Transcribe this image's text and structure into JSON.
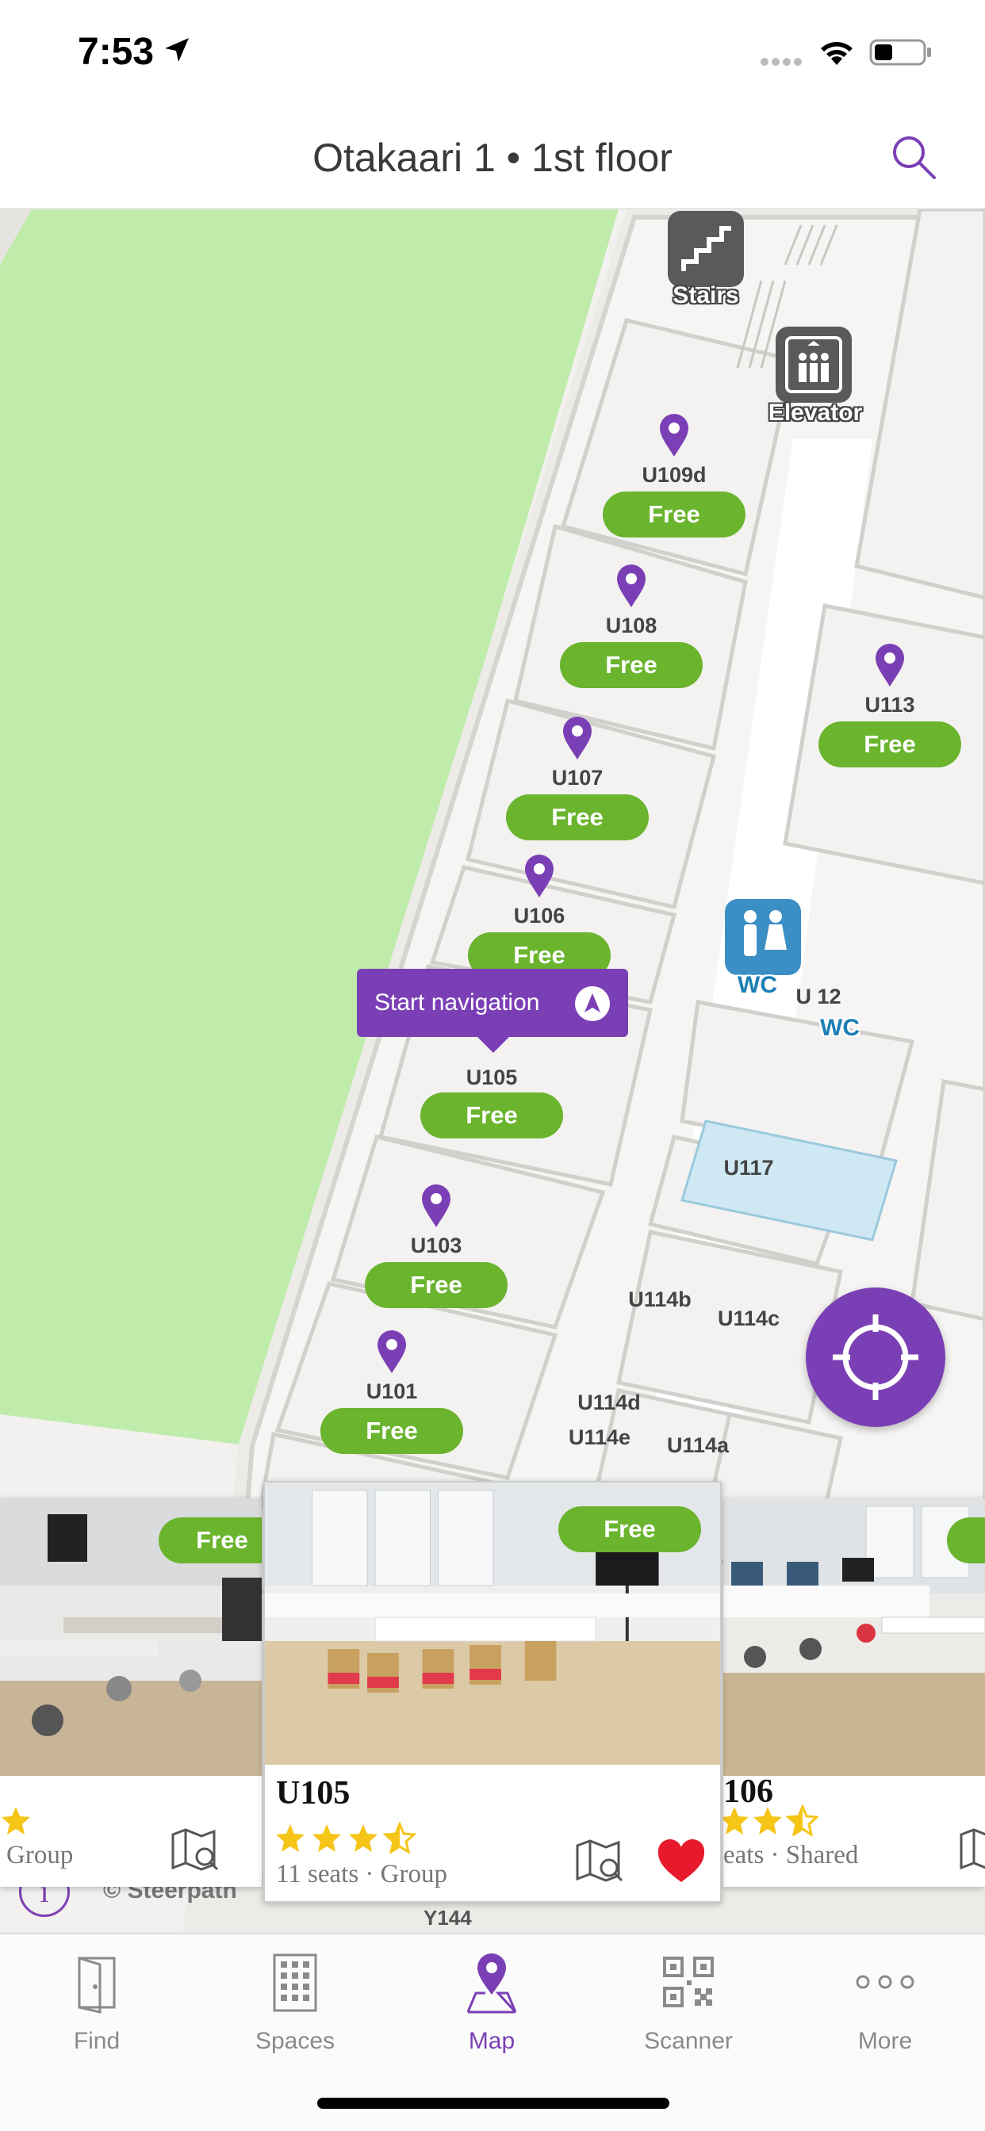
{
  "status_bar": {
    "time": "7:53"
  },
  "header": {
    "title": "Otakaari 1 • 1st floor"
  },
  "map": {
    "pois": {
      "stairs": "Stairs",
      "elevator": "Elevator",
      "wc1": "WC",
      "wc2": "WC"
    },
    "rooms": [
      {
        "name": "U109d",
        "status": "Free"
      },
      {
        "name": "U108",
        "status": "Free"
      },
      {
        "name": "U107",
        "status": "Free"
      },
      {
        "name": "U106",
        "status": "Free"
      },
      {
        "name": "U105",
        "status": "Free"
      },
      {
        "name": "U103",
        "status": "Free"
      },
      {
        "name": "U101",
        "status": "Free"
      },
      {
        "name": "U113",
        "status": "Free"
      }
    ],
    "plain_rooms": {
      "u112": "U 12",
      "u117": "U117",
      "u114b": "U114b",
      "u114c": "U114c",
      "u114d": "U114d",
      "u114e": "U114e",
      "u114a": "U114a",
      "y144": "Y144"
    },
    "navigation_tooltip": "Start navigation",
    "copyright": "© Steerpath",
    "info": "i"
  },
  "cards": [
    {
      "title": "",
      "status": "Free",
      "subtitle": "Group",
      "rating_visible": "partial"
    },
    {
      "title": "U105",
      "status": "Free",
      "subtitle": "11 seats · Group",
      "rating": 3.5,
      "favorite": true
    },
    {
      "title": "106",
      "status": "",
      "subtitle": "eats · Shared",
      "rating": 2.5
    }
  ],
  "tabs": [
    {
      "label": "Find",
      "icon": "door-icon"
    },
    {
      "label": "Spaces",
      "icon": "building-icon"
    },
    {
      "label": "Map",
      "icon": "map-pin-icon",
      "active": true
    },
    {
      "label": "Scanner",
      "icon": "qr-code-icon"
    },
    {
      "label": "More",
      "icon": "more-dots-icon"
    }
  ],
  "colors": {
    "accent": "#7b3fb5",
    "free": "#6ab42e",
    "park": "#c0ecab"
  }
}
